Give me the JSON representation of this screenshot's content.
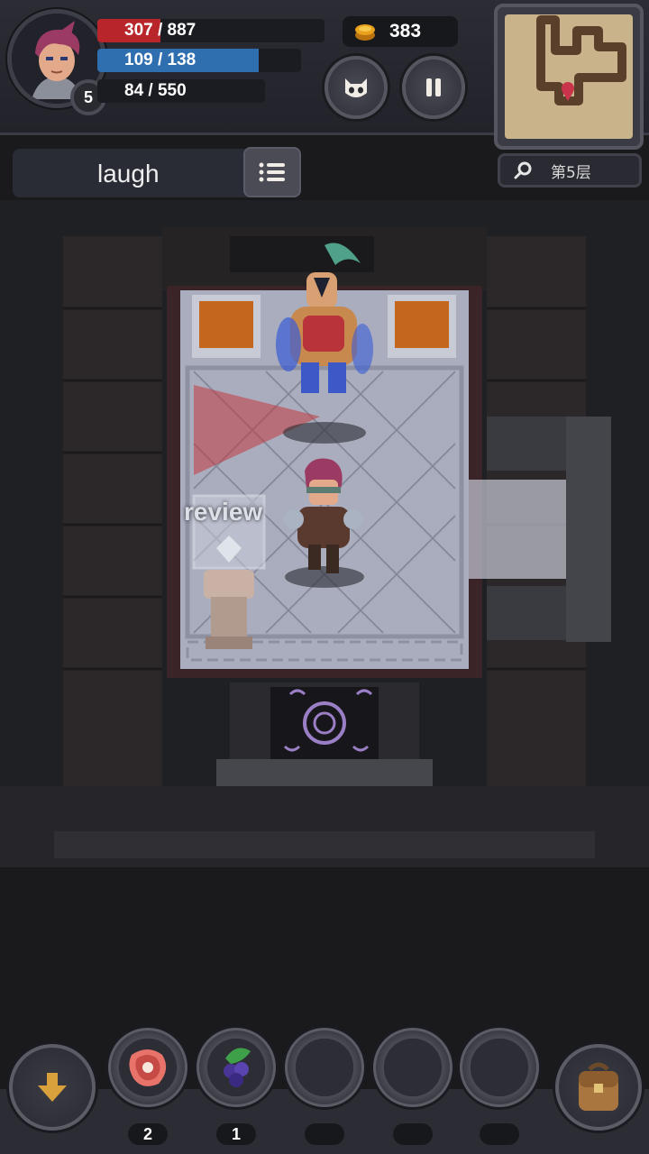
{
  "player": {
    "level": "5",
    "hp": {
      "text": "307 / 887",
      "current": 307,
      "max": 887
    },
    "mp": {
      "text": "109 / 138",
      "current": 109,
      "max": 138
    },
    "exp": {
      "text": "84 / 550",
      "current": 84,
      "max": 550
    }
  },
  "gold": "383",
  "floor": "第5层",
  "message": "laugh",
  "scene": {
    "object_label": "review"
  },
  "items": [
    {
      "icon": "meat-icon",
      "count": "2"
    },
    {
      "icon": "berry-icon",
      "count": "1"
    },
    {
      "icon": "empty-slot",
      "count": ""
    },
    {
      "icon": "empty-slot",
      "count": ""
    },
    {
      "icon": "empty-slot",
      "count": ""
    }
  ],
  "colors": {
    "hp": "#b8262b",
    "mp": "#2f6fb0",
    "gold": "#e8a21c",
    "rune": "#9a7fc6"
  }
}
